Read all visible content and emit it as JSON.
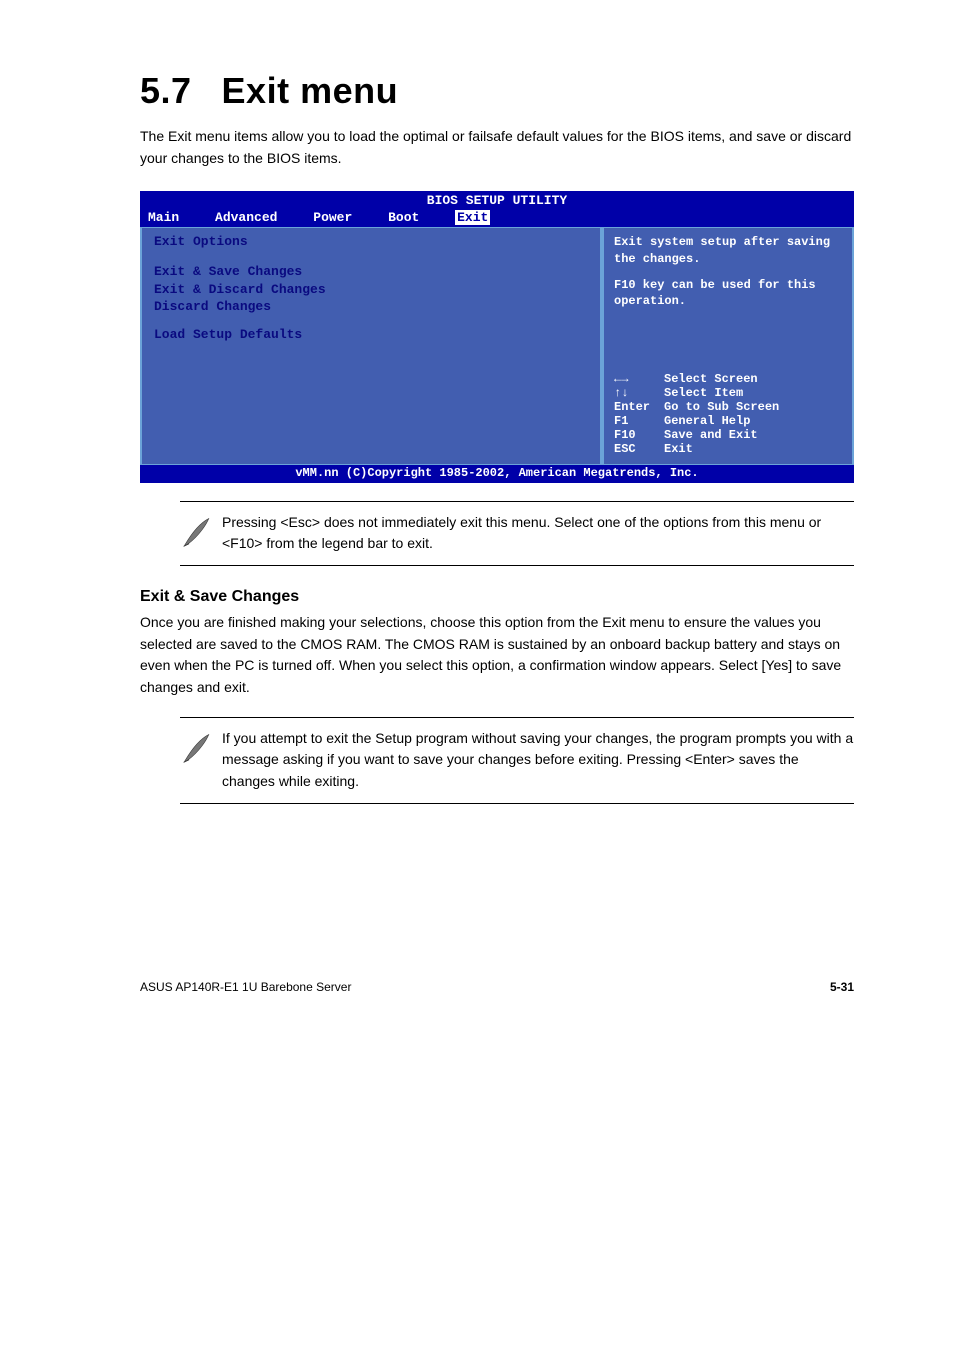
{
  "heading": {
    "number": "5.7",
    "title": "Exit menu"
  },
  "intro": "The Exit menu items allow you to load the optimal or failsafe default values for the BIOS items, and save or discard your changes to the BIOS items.",
  "bios": {
    "title": "BIOS SETUP UTILITY",
    "tabs": [
      "Main",
      "Advanced",
      "Power",
      "Boot",
      "Exit"
    ],
    "left_heading": "Exit Options",
    "items": [
      "Exit & Save Changes",
      "Exit & Discard Changes",
      "Discard Changes",
      "Load Setup Defaults"
    ],
    "help_line1": "Exit system setup after saving the changes.",
    "help_line2": "F10 key can be used for this operation.",
    "nav": [
      {
        "key": "←→",
        "label": "Select Screen"
      },
      {
        "key": "↑↓",
        "label": "Select Item"
      },
      {
        "key": "Enter",
        "label": "Go to Sub Screen"
      },
      {
        "key": "F1",
        "label": "General Help"
      },
      {
        "key": "F10",
        "label": "Save and Exit"
      },
      {
        "key": "ESC",
        "label": "Exit"
      }
    ],
    "footer": "vMM.nn (C)Copyright 1985-2002, American Megatrends, Inc."
  },
  "note1": "Pressing <Esc> does not immediately exit this menu. Select one of the options from this menu or <F10> from the legend bar to exit.",
  "section": {
    "title": "Exit & Save Changes",
    "p1": "Once you are finished making your selections, choose this option from the Exit menu to ensure the values you selected are saved to the CMOS RAM. The CMOS RAM is sustained by an onboard backup battery and stays on even when the PC is turned off. When you select this option, a confirmation window appears. Select [Yes] to save changes and exit."
  },
  "note2": "If you attempt to exit the Setup program without saving your changes, the program prompts you with a message asking if you want to save your changes before exiting. Pressing <Enter> saves the changes while exiting.",
  "page_footer": {
    "left": "ASUS AP140R-E1 1U Barebone Server",
    "right": "5-31"
  }
}
